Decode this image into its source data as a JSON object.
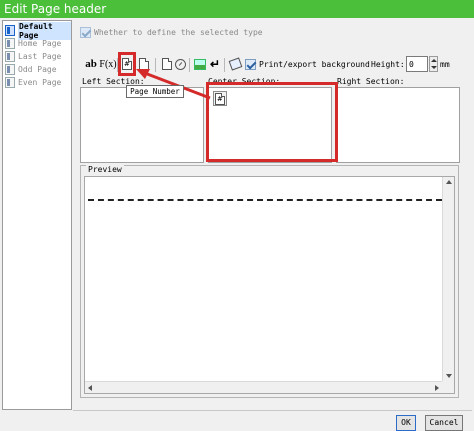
{
  "window": {
    "title": "Edit Page header"
  },
  "tree": {
    "items": [
      {
        "label": "Default Page",
        "selected": true
      },
      {
        "label": "Home Page",
        "selected": false
      },
      {
        "label": "Last Page",
        "selected": false
      },
      {
        "label": "Odd Page",
        "selected": false
      },
      {
        "label": "Even Page",
        "selected": false
      }
    ]
  },
  "define_type": {
    "label": "Whether to define the selected type",
    "checked": true
  },
  "toolbar": {
    "text_icon": "ab",
    "fx_icon": "F(x)",
    "page_glyph": "#",
    "print_label": "Print/export background",
    "print_checked": true,
    "height_label": "Height:",
    "height_value": "0",
    "unit": "mm"
  },
  "sections": {
    "left": "Left Section:",
    "center": "Center Section:",
    "right": "Right Section:",
    "center_glyph": "#"
  },
  "tooltip": "Page Number",
  "preview": {
    "label": "Preview"
  },
  "buttons": {
    "ok": "OK",
    "cancel": "Cancel"
  },
  "colors": {
    "titlebar": "#4bbf3a",
    "highlight": "#d42a2a",
    "selection": "#cfe4ff"
  }
}
